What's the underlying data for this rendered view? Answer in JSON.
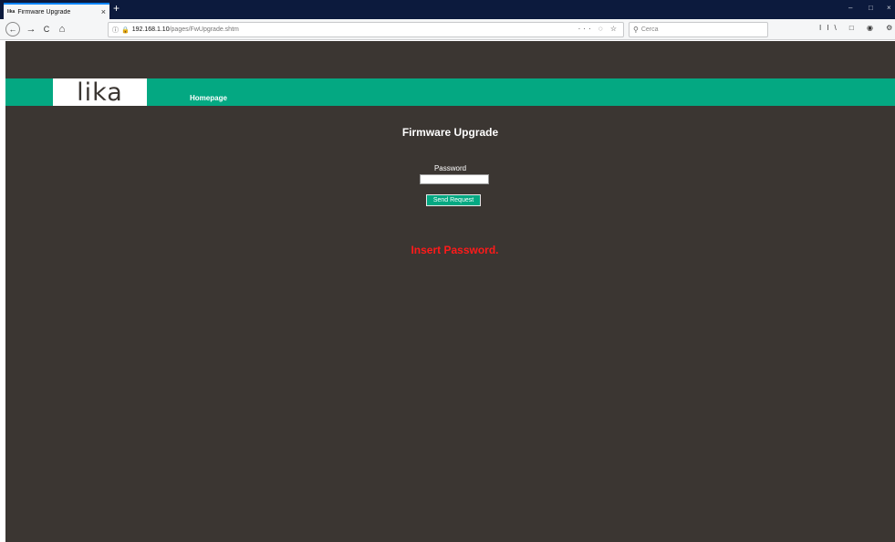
{
  "browser": {
    "tab": {
      "favicon": "lika",
      "title": "Firmware Upgrade",
      "close": "×"
    },
    "new_tab": "+",
    "window_controls": {
      "minimize": "–",
      "restore": "□",
      "close": "×"
    },
    "nav": {
      "back": "←",
      "forward": "→",
      "reload": "C",
      "home": "⌂"
    },
    "url": {
      "host": "192.168.1.10",
      "path": "/pages/FwUpgrade.shtm",
      "actions": "··· ◌ ☆"
    },
    "search": {
      "placeholder": "Cerca"
    },
    "toolbar_icons": "II\\ □ ◉ ⚙ ≡"
  },
  "site": {
    "logo": "lika",
    "nav": {
      "homepage": "Homepage"
    },
    "heading": "Firmware Upgrade",
    "password_label": "Password",
    "password_value": "",
    "send_button": "Send Request",
    "error_message": "Insert Password."
  }
}
